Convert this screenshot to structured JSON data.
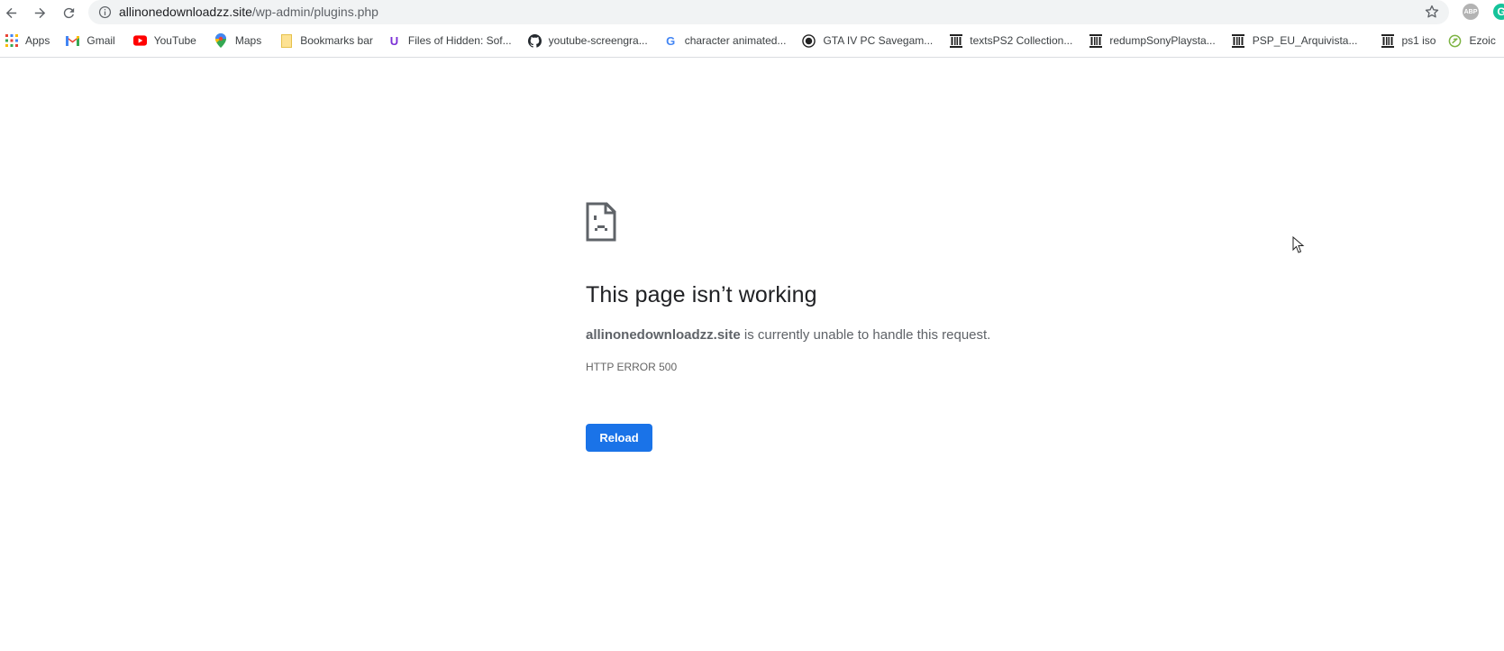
{
  "browser": {
    "url_host": "allinonedownloadzz.site",
    "url_path": "/wp-admin/plugins.php",
    "nav": {
      "back_icon": "arrow-left-icon",
      "forward_icon": "arrow-right-icon",
      "reload_icon": "reload-icon",
      "site_info_icon": "info-icon",
      "bookmark_star_icon": "star-icon"
    },
    "extensions": [
      {
        "name": "adblock-plus",
        "label": "ABP",
        "color": "#b3b3b3"
      },
      {
        "name": "grammarly",
        "label": "G",
        "color": "#15c39a"
      }
    ]
  },
  "bookmarks": [
    {
      "label": "Apps",
      "icon": "apps-grid-icon"
    },
    {
      "label": "Gmail",
      "icon": "gmail-icon"
    },
    {
      "label": "YouTube",
      "icon": "youtube-icon"
    },
    {
      "label": "Maps",
      "icon": "maps-pin-icon"
    },
    {
      "label": "Bookmarks bar",
      "icon": "folder-icon"
    },
    {
      "label": "Files of Hidden: Sof...",
      "icon": "u-logo-icon"
    },
    {
      "label": "youtube-screengra...",
      "icon": "github-icon"
    },
    {
      "label": "character animated...",
      "icon": "google-icon"
    },
    {
      "label": "GTA IV PC Savegam...",
      "icon": "gta-site-icon"
    },
    {
      "label": "textsPS2 Collection...",
      "icon": "archive-org-icon"
    },
    {
      "label": "redumpSonyPlaysta...",
      "icon": "archive-org-icon"
    },
    {
      "label": "PSP_EU_Arquivista...",
      "icon": "archive-org-icon"
    },
    {
      "label": "ps1 iso",
      "icon": "archive-org-icon"
    },
    {
      "label": "Ezoic",
      "icon": "ezoic-icon"
    }
  ],
  "error_page": {
    "icon": "sad-page-icon",
    "title": "This page isn’t working",
    "host": "allinonedownloadzz.site",
    "message": " is currently unable to handle this request.",
    "error_code": "HTTP ERROR 500",
    "reload_label": "Reload",
    "accent_color": "#1a73e8"
  }
}
